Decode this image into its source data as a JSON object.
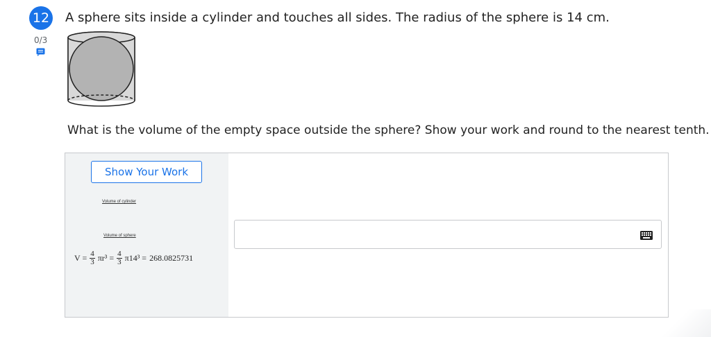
{
  "question": {
    "number": "12",
    "score": "0/3",
    "text": "A sphere sits inside a cylinder and touches all sides. The radius of the sphere is 14 cm.",
    "prompt": "What is the volume of the empty space outside the sphere? Show your work and round to the nearest tenth."
  },
  "work": {
    "button_label": "Show Your Work",
    "label_cylinder": "Volume of cylinder",
    "label_sphere": "Volume of sphere",
    "formula": {
      "lhs": "V =",
      "frac_num": "4",
      "frac_den": "3",
      "term1": "πr³ =",
      "term2": "π14³ =",
      "result": "268.0825731"
    }
  },
  "answer": {
    "value": "",
    "keyboard_icon": "keyboard-icon"
  },
  "colors": {
    "accent": "#1a73e8",
    "panel_bg": "#f1f3f4",
    "sphere_fill": "#b3b3b3"
  }
}
